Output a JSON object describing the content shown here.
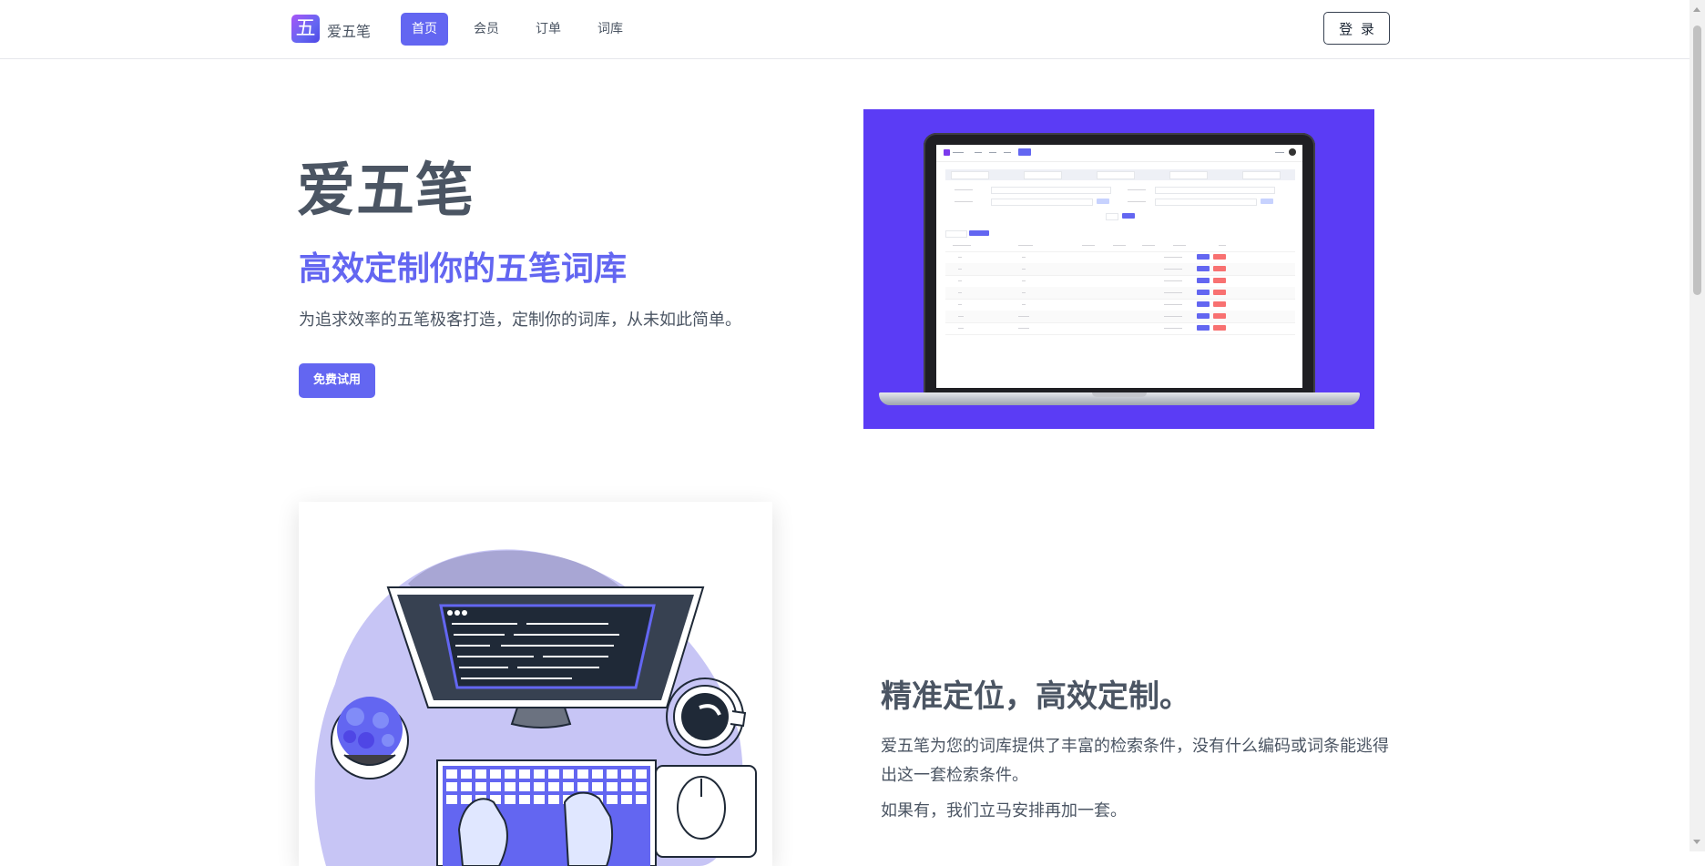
{
  "nav": {
    "logo_char": "五",
    "brand": "爱五笔",
    "items": [
      {
        "label": "首页",
        "active": true
      },
      {
        "label": "会员",
        "active": false
      },
      {
        "label": "订单",
        "active": false
      },
      {
        "label": "词库",
        "active": false
      }
    ],
    "login": "登 录"
  },
  "hero": {
    "title": "爱五笔",
    "subtitle": "高效定制你的五笔词库",
    "description": "为追求效率的五笔极客打造，定制你的词库，从未如此简单。",
    "cta": "免费试用",
    "image_bg": "#5b3cf5"
  },
  "feature": {
    "title": "精准定位，高效定制。",
    "description": "爱五笔为您的词库提供了丰富的检索条件，没有什么编码或词条能逃得出这一套检索条件。",
    "description2": "如果有，我们立马安排再加一套。"
  },
  "colors": {
    "accent": "#6366f1",
    "text": "#4b5563",
    "illustration_blob": "#c7c5f5",
    "illustration_dark": "#a8a6d4"
  }
}
